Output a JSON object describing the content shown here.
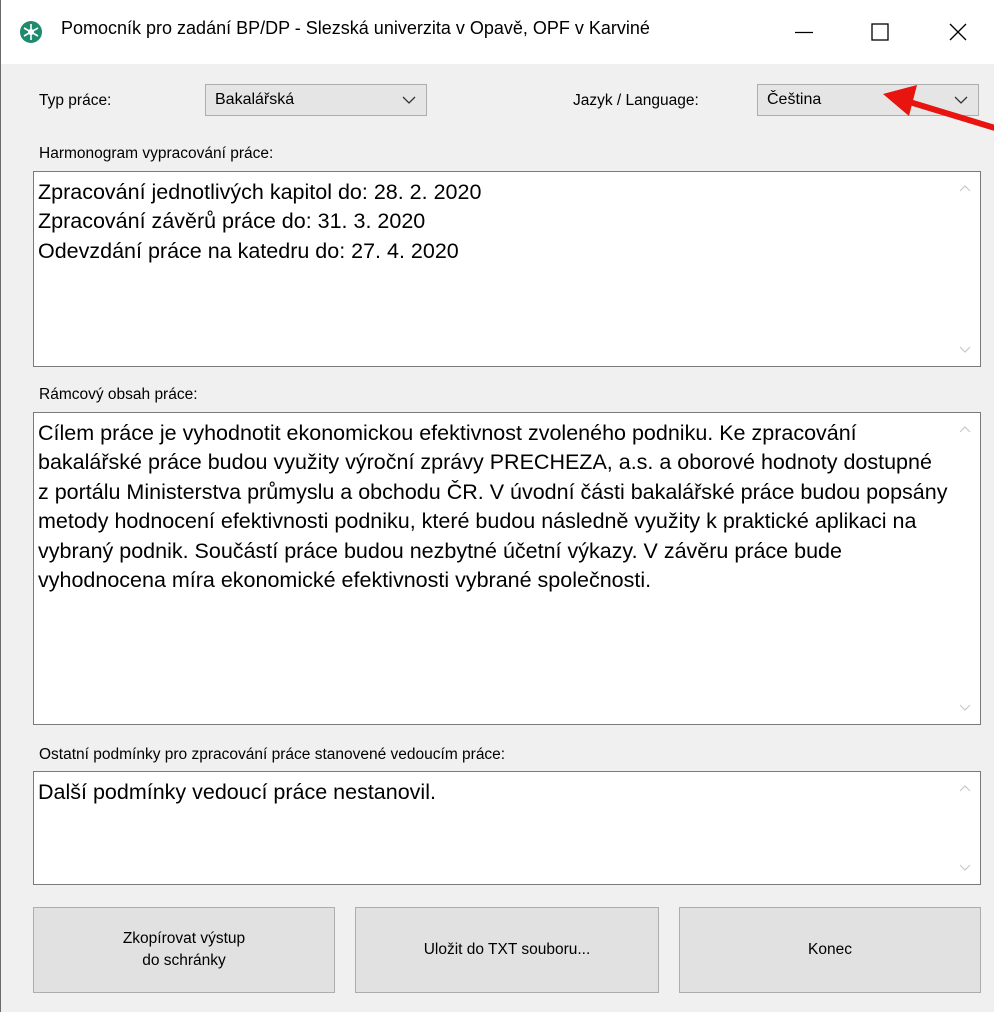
{
  "window": {
    "title": "Pomocník pro zadání BP/DP - Slezská univerzita v Opavě, OPF v Karviné"
  },
  "type": {
    "label": "Typ práce:",
    "value": "Bakalářská"
  },
  "language": {
    "label": "Jazyk / Language:",
    "value": "Čeština"
  },
  "schedule": {
    "label": "Harmonogram vypracování práce:",
    "text": "Zpracování jednotlivých kapitol do: 28. 2. 2020\nZpracování závěrů práce do: 31. 3. 2020\nOdevzdání práce na katedru do: 27. 4. 2020"
  },
  "content": {
    "label": "Rámcový obsah práce:",
    "text": "Cílem práce je vyhodnotit ekonomickou efektivnost zvoleného podniku. Ke zpracování bakalářské práce budou využity výroční zprávy PRECHEZA, a.s. a oborové hodnoty dostupné z portálu Ministerstva průmyslu a obchodu ČR. V úvodní části bakalářské práce budou popsány metody hodnocení efektivnosti podniku, které budou následně využity k praktické aplikaci na vybraný podnik. Součástí práce budou nezbytné účetní výkazy. V závěru práce bude vyhodnocena míra ekonomické efektivnosti vybrané společnosti."
  },
  "conditions": {
    "label": "Ostatní podmínky pro zpracování práce stanovené vedoucím práce:",
    "text": "Další podmínky vedoucí práce nestanovil."
  },
  "buttons": {
    "copy": "Zkopírovat výstup\ndo schránky",
    "save": "Uložit do TXT souboru...",
    "exit": "Konec"
  },
  "colors": {
    "annotation_arrow": "#e8140f",
    "app_icon": "#1e8a6e"
  }
}
